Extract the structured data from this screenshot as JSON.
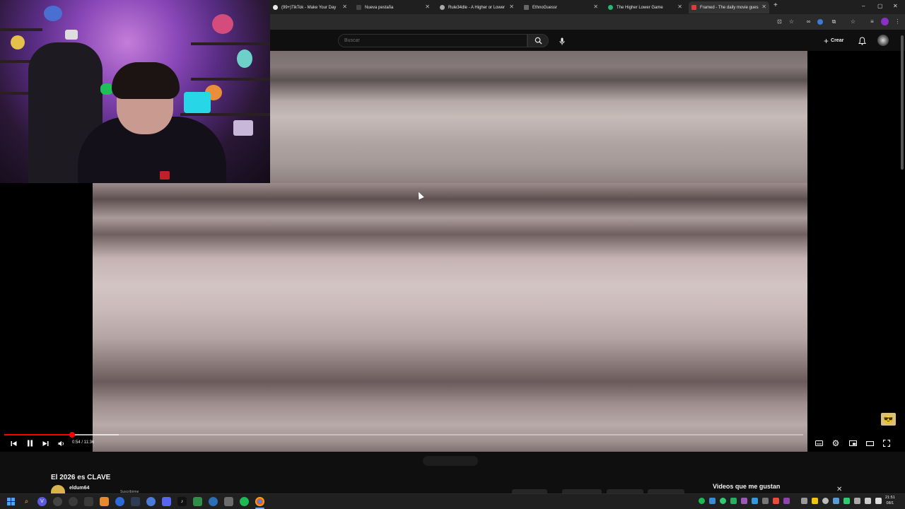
{
  "browser": {
    "tabs": [
      {
        "label": "(99+)TikTok - Make Your Day",
        "color": "#e9e9e9"
      },
      {
        "label": "Nueva pestaña",
        "color": "#444"
      },
      {
        "label": "Rule34dle - A Higher or Lower",
        "color": "#aaaaaa"
      },
      {
        "label": "EthnoGuessr",
        "color": "#666"
      },
      {
        "label": "The Higher Lower Game",
        "color": "#2bb673"
      },
      {
        "label": "Framed - The daily movie gues",
        "color": "#e03a3a"
      }
    ],
    "new_tab": "+",
    "window_controls": {
      "minimize": "–",
      "maximize": "▢",
      "close": "✕"
    }
  },
  "youtube": {
    "search_placeholder": "Buscar",
    "create_label": "Crear",
    "video": {
      "title": "El 2026 es CLAVE",
      "channel": "eldum64",
      "channel_hint": "Suscribirme",
      "time": "0:54 / 11:36",
      "progress_fraction": 0.085,
      "loaded_fraction": 0.143
    },
    "playlist_title": "Videos que me gustan",
    "playlist_close": "✕"
  },
  "taskbar": {
    "clock_time": "21:51",
    "clock_date": "08/1"
  },
  "icons": [
    "windows-start-icon",
    "search-icon",
    "browser-icon",
    "tiktok-icon",
    "spotify-icon",
    "chrome-icon",
    "discord-icon"
  ]
}
